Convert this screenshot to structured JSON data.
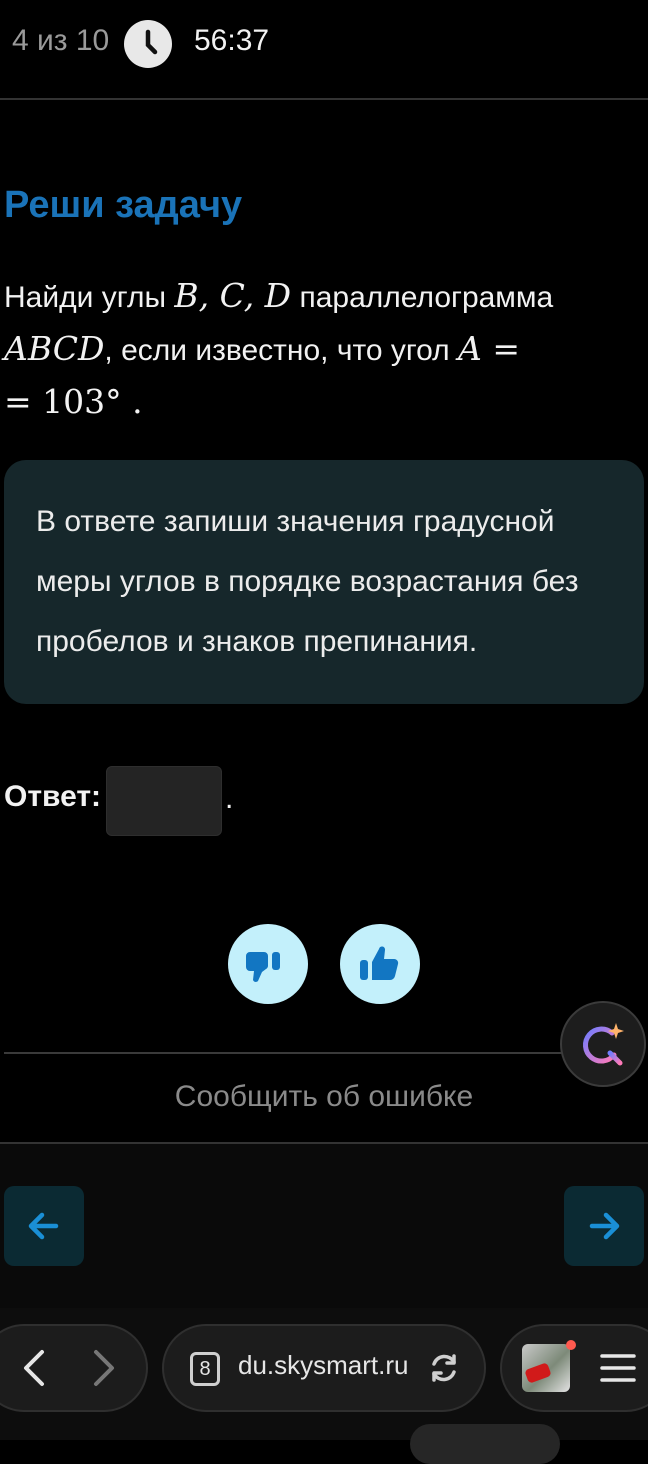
{
  "header": {
    "progress": "4 из 10",
    "timer": "56:37"
  },
  "task": {
    "title": "Реши задачу",
    "line1_prefix": "Найди углы ",
    "angles_list": "B, C, D",
    "line1_suffix": " параллелограмма",
    "figure_name": "ABCD",
    "line2_middle": ", если известно, что угол ",
    "given_angle": "A =",
    "angle_value": "= 103°",
    "period": " ."
  },
  "hint": {
    "text": "В ответе запиши значения градусной меры углов в порядке возрастания без пробелов и знаков препинания."
  },
  "answer": {
    "label": "Ответ:",
    "value": "",
    "suffix": "."
  },
  "footer": {
    "report_label": "Сообщить об ошибке"
  },
  "browser": {
    "tab_count": "8",
    "url": "du.skysmart.ru"
  },
  "colors": {
    "title": "#1a73b8",
    "hint_bg": "#16272b",
    "vote_bg": "#c3f0fb",
    "nav_bg": "#0b2a33",
    "nav_arrow": "#1a8fd6"
  }
}
